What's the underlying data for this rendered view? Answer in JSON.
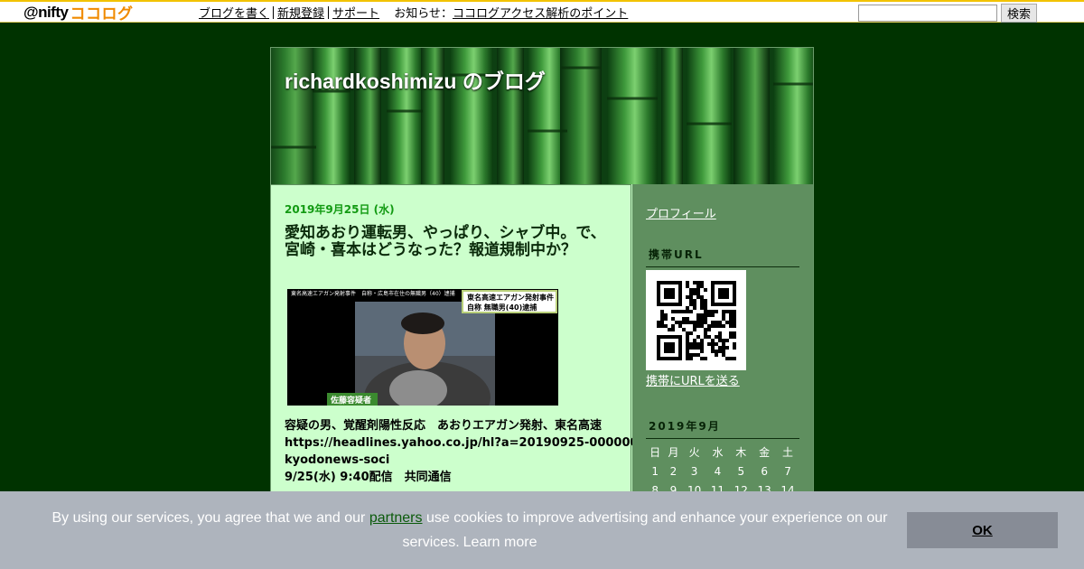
{
  "topbar": {
    "logo_prefix": "@nifty",
    "logo_brand": "ココログ",
    "links": [
      "ブログを書く",
      "新規登録",
      "サポート"
    ],
    "notice_label": "お知らせ",
    "notice_sep": "：",
    "notice_link": "ココログアクセス解析のポイント",
    "search_placeholder": "",
    "search_button": "検索"
  },
  "blog": {
    "title": "richardkoshimizu のブログ"
  },
  "post": {
    "date": "2019年9月25日 (水)",
    "title": "愛知あおり運転男、やっぱり、シャブ中。で、宮崎・喜本はどうなった？報道規制中か？",
    "image": {
      "top_caption": "東名高速エアガン発射事件　自称・広島市在住の無職男（40）逮捕",
      "box_title": "東名高速エアガン発射事件",
      "box_sub": "自称 無職男(40)逮捕",
      "name_tag": "佐藤容疑者"
    },
    "body_lines": [
      "容疑の男、覚醒剤陽性反応　あおりエアガン発射、東名高速",
      "https://headlines.yahoo.co.jp/hl?a=20190925-00000037-",
      "kyodonews-soci",
      "9/25(水) 9:40配信　共同通信"
    ]
  },
  "sidebar": {
    "profile_link": "プロフィール",
    "mobile_heading": "携帯URL",
    "qr_icon": "qr-code-icon",
    "send_url_link": "携帯にURLを送る",
    "calendar_heading": "2019年9月",
    "weekdays": [
      "日",
      "月",
      "火",
      "水",
      "木",
      "金",
      "土"
    ],
    "weeks": [
      [
        "1",
        "2",
        "3",
        "4",
        "5",
        "6",
        "7"
      ],
      [
        "8",
        "9",
        "10",
        "11",
        "12",
        "13",
        "14"
      ]
    ]
  },
  "cookie": {
    "text_before": "By using our services, you agree that we and our ",
    "partners_link": "partners",
    "text_after": " use cookies to improve advertising and enhance your experience on our services.",
    "learn_more": "Learn more",
    "ok_button": "OK"
  },
  "colors": {
    "page_bg": "#003300",
    "main_bg": "#ccffcc",
    "sidebar_bg": "#5f8f5f",
    "date_color": "#129a12",
    "cookie_bg": "#aeb4bd",
    "logo_orange": "#f08a00"
  }
}
